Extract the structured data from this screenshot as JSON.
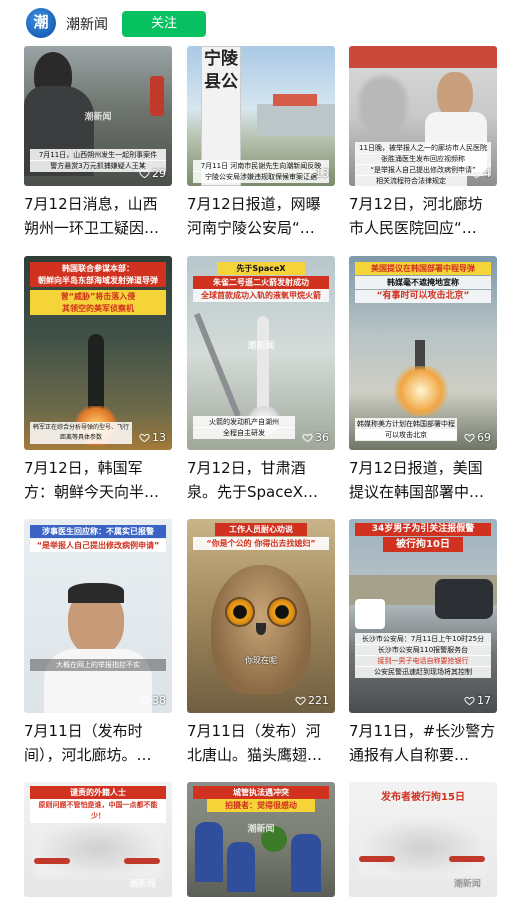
{
  "header": {
    "avatar_text": "潮",
    "account_name": "潮新闻",
    "follow_label": "关注"
  },
  "cards": [
    {
      "title": "7月12日消息，山西朔州一环卫工疑因…",
      "likes": "29",
      "overlay_texts": [
        "7月11日，山西朔州发生一起刑事案件",
        "警方悬赏3万元抓捕嫌疑人王某"
      ],
      "watermark": "潮新闻"
    },
    {
      "title": "7月12日报道，网曝河南宁陵公安局“…",
      "likes": "13",
      "overlay_texts": [
        "宁陵县公",
        "7月11日 河南市民谢先生向潮新闻反映",
        "宁陵公安局涉嫌违规取保候审案证据"
      ],
      "watermark": ""
    },
    {
      "title": "7月12日，河北廊坊市人民医院回应“…",
      "likes": "4",
      "overlay_texts": [
        "11日晚，被举报人之一的廊坊市人民医院",
        "张胜涌医生发布回应视频称",
        "“是举报人自己提出修改病例申请”",
        "相关流程符合法律规定"
      ],
      "watermark": ""
    },
    {
      "title": "7月12日，韩国军方：朝鲜今天向半…",
      "likes": "13",
      "overlay_texts": [
        "韩国联合参谋本部：",
        "朝鲜向半岛东部海域发射弹道导弹",
        "曾“威胁”将击落入侵",
        "其领空的美军侦察机",
        "韩军正在综合分析导弹的型号、飞行距离等具体参数"
      ],
      "watermark": ""
    },
    {
      "title": "7月12日，甘肃酒泉。先于SpaceX…",
      "likes": "36",
      "overlay_texts": [
        "先于SpaceX",
        "朱雀二号遥二火箭发射成功",
        "全球首款成功入轨的液氧甲烷火箭",
        "火箭的发动机产自湖州",
        "全程自主研发"
      ],
      "watermark": "潮新闻"
    },
    {
      "title": "7月12日报道，美国提议在韩国部署中…",
      "likes": "69",
      "overlay_texts": [
        "美国提议在韩国部署中程导弹",
        "韩媒毫不遮掩地宣称",
        "“有事时可以攻击北京”",
        "韩媒称美方计划在韩国部署中程导弹",
        "可以攻击北京"
      ],
      "watermark": ""
    },
    {
      "title": "7月11日（发布时间），河北廊坊。…",
      "likes": "38",
      "overlay_texts": [
        "涉事医生回应称：不属实已报警",
        "“是举报人自己提出修改病例申请”",
        "大概在网上的举报指控不实"
      ],
      "watermark": ""
    },
    {
      "title": "7月11日（发布）河北唐山。猫头鹰翅…",
      "likes": "221",
      "overlay_texts": [
        "工作人员耐心劝说",
        "“你是个公的 你得出去找媳妇”",
        "你现在呢"
      ],
      "watermark": ""
    },
    {
      "title": "7月11日，#长沙警方通报有人自称要…",
      "likes": "17",
      "overlay_texts": [
        "34岁男子为引关注报假警",
        "被行拘10日",
        "长沙市公安局：7月11日上午10时25分",
        "长沙市公安局110报警服务台",
        "接到一男子电话自称要抢银行",
        "公安民警迅速赶到现场将其控制"
      ],
      "watermark": ""
    },
    {
      "title": "",
      "likes": "",
      "overlay_texts": [
        "谴责的外籍人士",
        "原则问题不管怕是谁，中国一点都不能少！"
      ],
      "watermark": "潮新闻"
    },
    {
      "title": "",
      "likes": "",
      "overlay_texts": [
        "城管执法遇冲突",
        "拍摄者：觉得很感动"
      ],
      "watermark": "潮新闻"
    },
    {
      "title": "",
      "likes": "",
      "overlay_texts": [
        "发布者被行拘15日"
      ],
      "watermark": "潮新闻"
    }
  ],
  "colors": {
    "follow_green": "#07c160",
    "avatar_blue": "#0b4fa6"
  }
}
